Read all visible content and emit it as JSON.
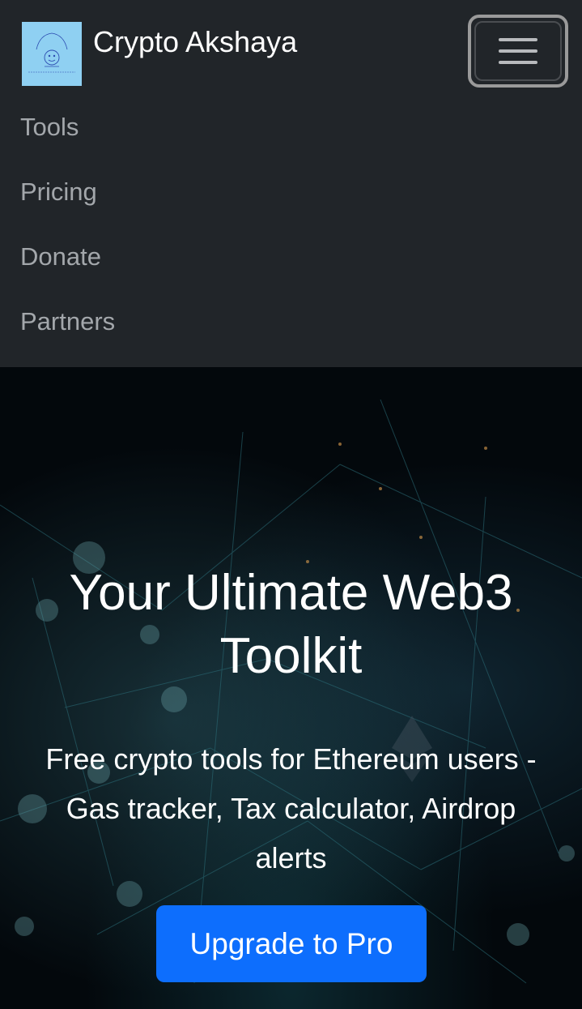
{
  "navbar": {
    "brand_name": "Crypto Akshaya",
    "logo_text": "Crypto Akshaya",
    "items": [
      {
        "label": "Tools"
      },
      {
        "label": "Pricing"
      },
      {
        "label": "Donate"
      },
      {
        "label": "Partners"
      }
    ]
  },
  "hero": {
    "title_line1": "Your Ultimate Web3",
    "title_line2": "Toolkit",
    "subtitle_line1": "Free crypto tools for Ethereum users -",
    "subtitle_line2": "Gas tracker, Tax calculator, Airdrop",
    "subtitle_line3": "alerts",
    "cta_label": "Upgrade to Pro"
  },
  "colors": {
    "navbar_bg": "#212529",
    "cta_bg": "#0d6efd",
    "logo_bg": "#8fd0f2"
  }
}
